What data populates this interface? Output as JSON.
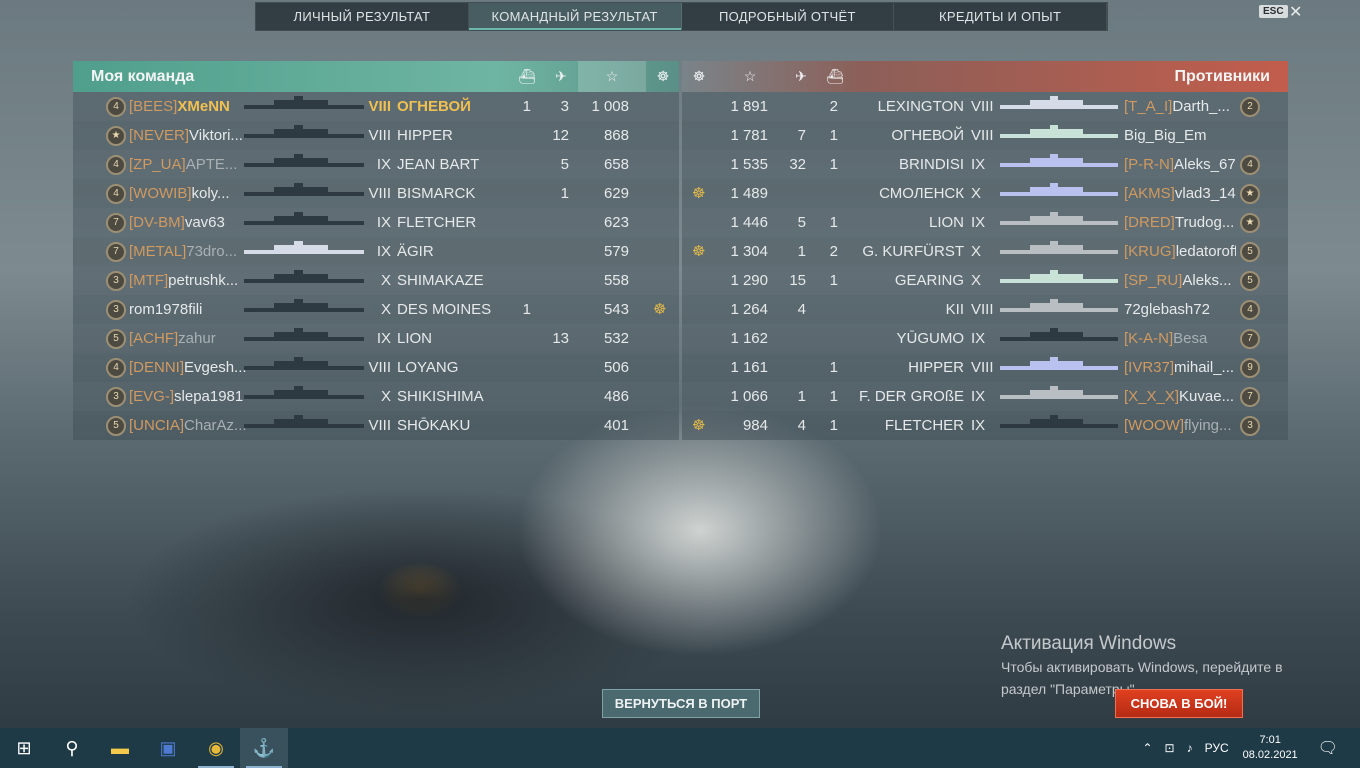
{
  "tabs": [
    {
      "label": "ЛИЧНЫЙ РЕЗУЛЬТАТ",
      "active": false
    },
    {
      "label": "КОМАНДНЫЙ РЕЗУЛЬТАТ",
      "active": true
    },
    {
      "label": "ПОДРОБНЫЙ ОТЧЁТ",
      "active": false
    },
    {
      "label": "КРЕДИТЫ И ОПЫТ",
      "active": false
    }
  ],
  "esc_label": "ESC",
  "close_glyph": "✕",
  "my_team": {
    "title": "Моя команда",
    "rows": [
      {
        "rank": "4",
        "clan": "[BEES]",
        "name": "XMeNN",
        "tier": "VIII",
        "ship": "ОГНЕВОЙ",
        "a": "1",
        "b": "3",
        "xp": "1 008",
        "medal": "",
        "self": true,
        "sil": "dark"
      },
      {
        "rank": "★",
        "clan": "[NEVER]",
        "name": "Viktori...",
        "tier": "VIII",
        "ship": "HIPPER",
        "a": "",
        "b": "12",
        "xp": "868",
        "medal": "",
        "sil": "dark"
      },
      {
        "rank": "4",
        "clan": "[ZP_UA]",
        "name": "APTE...",
        "tier": "IX",
        "ship": "JEAN BART",
        "a": "",
        "b": "5",
        "xp": "658",
        "medal": "",
        "sil": "dark"
      },
      {
        "rank": "4",
        "clan": "[WOWIB]",
        "name": "koly...",
        "tier": "VIII",
        "ship": "BISMARCK",
        "a": "",
        "b": "1",
        "xp": "629",
        "medal": "",
        "sil": "dark"
      },
      {
        "rank": "7",
        "clan": "[DV-BM]",
        "name": "vav63",
        "tier": "IX",
        "ship": "FLETCHER",
        "a": "",
        "b": "",
        "xp": "623",
        "medal": "",
        "sil": "dark"
      },
      {
        "rank": "7",
        "clan": "[METAL]",
        "name": "73dro...",
        "tier": "IX",
        "ship": "ÄGIR",
        "a": "",
        "b": "",
        "xp": "579",
        "medal": "",
        "sil": "light"
      },
      {
        "rank": "3",
        "clan": "[MTF]",
        "name": "petrushk...",
        "tier": "X",
        "ship": "SHIMAKAZE",
        "a": "",
        "b": "",
        "xp": "558",
        "medal": "",
        "sil": "dark"
      },
      {
        "rank": "3",
        "clan": "",
        "name": "rom1978fili",
        "tier": "X",
        "ship": "DES MOINES",
        "a": "1",
        "b": "",
        "xp": "543",
        "medal": "☸",
        "sil": "dark"
      },
      {
        "rank": "5",
        "clan": "[ACHF]",
        "name": "zahur",
        "tier": "IX",
        "ship": "LION",
        "a": "",
        "b": "13",
        "xp": "532",
        "medal": "",
        "sil": "dark"
      },
      {
        "rank": "4",
        "clan": "[DENNI]",
        "name": "Evgesh...",
        "tier": "VIII",
        "ship": "LOYANG",
        "a": "",
        "b": "",
        "xp": "506",
        "medal": "",
        "sil": "dark"
      },
      {
        "rank": "3",
        "clan": "[EVG-]",
        "name": "slepa1981",
        "tier": "X",
        "ship": "SHIKISHIMA",
        "a": "",
        "b": "",
        "xp": "486",
        "medal": "",
        "sil": "dark"
      },
      {
        "rank": "5",
        "clan": "[UNCIA]",
        "name": "CharAz...",
        "tier": "VIII",
        "ship": "SHŌKAKU",
        "a": "",
        "b": "",
        "xp": "401",
        "medal": "",
        "sil": "dark"
      }
    ]
  },
  "enemy_team": {
    "title": "Противники",
    "rows": [
      {
        "medal": "",
        "xp": "1 891",
        "b": "",
        "a": "2",
        "ship": "LEXINGTON",
        "tier": "VIII",
        "clan": "[T_A_I]",
        "name": "Darth_...",
        "rank": "2",
        "sil": "light"
      },
      {
        "medal": "",
        "xp": "1 781",
        "b": "7",
        "a": "1",
        "ship": "ОГНЕВОЙ",
        "tier": "VIII",
        "clan": "",
        "name": "Big_Big_Em",
        "rank": "",
        "sil": "pale"
      },
      {
        "medal": "",
        "xp": "1 535",
        "b": "32",
        "a": "1",
        "ship": "BRINDISI",
        "tier": "IX",
        "clan": "[P-R-N]",
        "name": "Aleks_67",
        "rank": "4",
        "sil": "purp"
      },
      {
        "medal": "☸",
        "xp": "1 489",
        "b": "",
        "a": "",
        "ship": "СМОЛЕНСК",
        "tier": "X",
        "clan": "[AKMS]",
        "name": "vlad3_14",
        "rank": "★",
        "sil": "purp"
      },
      {
        "medal": "",
        "xp": "1 446",
        "b": "5",
        "a": "1",
        "ship": "LION",
        "tier": "IX",
        "clan": "[DRED]",
        "name": "Trudog...",
        "rank": "★",
        "sil": "grey"
      },
      {
        "medal": "☸",
        "xp": "1 304",
        "b": "1",
        "a": "2",
        "ship": "G. KURFÜRST",
        "tier": "X",
        "clan": "[KRUG]",
        "name": "ledatoroff",
        "rank": "5",
        "sil": "grey"
      },
      {
        "medal": "",
        "xp": "1 290",
        "b": "15",
        "a": "1",
        "ship": "GEARING",
        "tier": "X",
        "clan": "[SP_RU]",
        "name": "Aleks...",
        "rank": "5",
        "sil": "pale"
      },
      {
        "medal": "",
        "xp": "1 264",
        "b": "4",
        "a": "",
        "ship": "KII",
        "tier": "VIII",
        "clan": "",
        "name": "72glebash72",
        "rank": "4",
        "sil": "grey"
      },
      {
        "medal": "",
        "xp": "1 162",
        "b": "",
        "a": "",
        "ship": "YŪGUMO",
        "tier": "IX",
        "clan": "[K-A-N]",
        "name": "Besa",
        "rank": "7",
        "sil": "dark"
      },
      {
        "medal": "",
        "xp": "1 161",
        "b": "",
        "a": "1",
        "ship": "HIPPER",
        "tier": "VIII",
        "clan": "[IVR37]",
        "name": "mihail_...",
        "rank": "9",
        "sil": "purp"
      },
      {
        "medal": "",
        "xp": "1 066",
        "b": "1",
        "a": "1",
        "ship": "F. DER GROßE",
        "tier": "IX",
        "clan": "[X_X_X]",
        "name": "Kuvae...",
        "rank": "7",
        "sil": "grey"
      },
      {
        "medal": "☸",
        "xp": "984",
        "b": "4",
        "a": "1",
        "ship": "FLETCHER",
        "tier": "IX",
        "clan": "[WOOW]",
        "name": "flying...",
        "rank": "3",
        "sil": "dark"
      }
    ]
  },
  "buttons": {
    "port": "ВЕРНУТЬСЯ В ПОРТ",
    "battle": "СНОВА В БОЙ!"
  },
  "activation": {
    "title": "Активация Windows",
    "line1": "Чтобы активировать Windows, перейдите в",
    "line2": "раздел \"Параметры\"."
  },
  "taskbar": {
    "lang": "РУС",
    "time": "7:01",
    "date": "08.02.2021"
  }
}
